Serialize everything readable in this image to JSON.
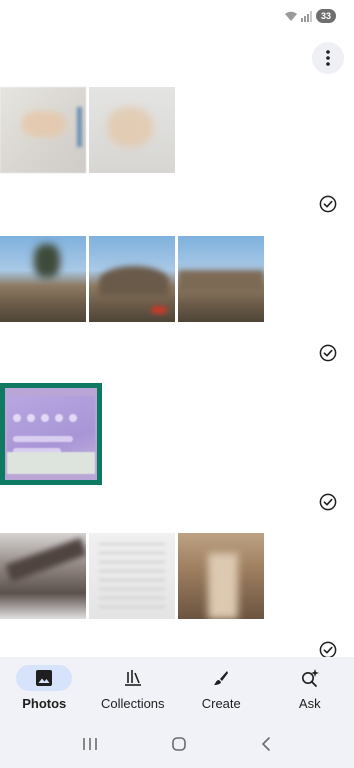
{
  "status_bar": {
    "battery": "33",
    "icons": [
      "wifi-icon",
      "signal-icon",
      "battery-icon"
    ]
  },
  "header": {
    "more_icon": "more-vert-icon"
  },
  "groups": [
    {
      "photos": [
        "document-photo",
        "document-photo"
      ],
      "selected_icon": "check-circle-icon"
    },
    {
      "photos": [
        "outdoor-photo",
        "outdoor-photo",
        "outdoor-photo"
      ],
      "selected_icon": "check-circle-icon"
    },
    {
      "photos": [
        "screenshot-photo"
      ],
      "selected_icon": "check-circle-icon",
      "highlighted": true
    },
    {
      "photos": [
        "building-photo",
        "document-photo",
        "street-photo"
      ],
      "selected_icon": "check-circle-icon"
    }
  ],
  "bottom_nav": {
    "items": [
      {
        "label": "Photos",
        "icon": "photo-icon",
        "active": true
      },
      {
        "label": "Collections",
        "icon": "collections-icon",
        "active": false
      },
      {
        "label": "Create",
        "icon": "brush-icon",
        "active": false
      },
      {
        "label": "Ask",
        "icon": "sparkle-search-icon",
        "active": false
      }
    ]
  },
  "system_nav": {
    "icons": [
      "recents-icon",
      "home-icon",
      "back-icon"
    ]
  },
  "colors": {
    "accent": "#d7e3fb",
    "nav_background": "#f0f2f8",
    "highlight_border": "#0e7a62"
  }
}
